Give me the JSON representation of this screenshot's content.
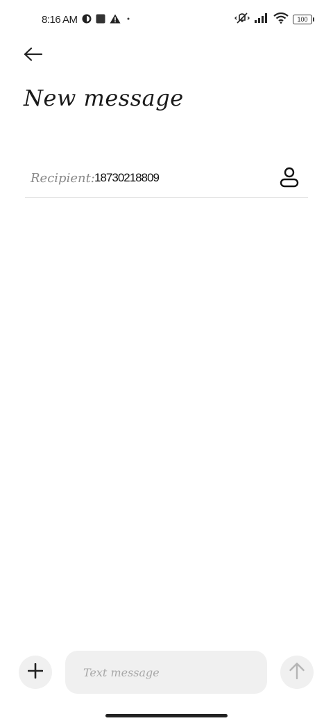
{
  "status_bar": {
    "time": "8:16 AM",
    "battery_level": "100"
  },
  "header": {
    "title": "New message"
  },
  "recipient": {
    "label": "Recipient:",
    "value": "18730218809"
  },
  "composer": {
    "placeholder": "Text message"
  },
  "colors": {
    "background": "#ffffff",
    "surface": "#f0f0f0",
    "text_primary": "#1a1a1a",
    "text_hint": "#a8a8a8",
    "divider": "#d9d9d9"
  },
  "icons": {
    "back": "arrow-left-icon",
    "contact": "person-icon",
    "add": "plus-icon",
    "send": "arrow-up-icon"
  }
}
